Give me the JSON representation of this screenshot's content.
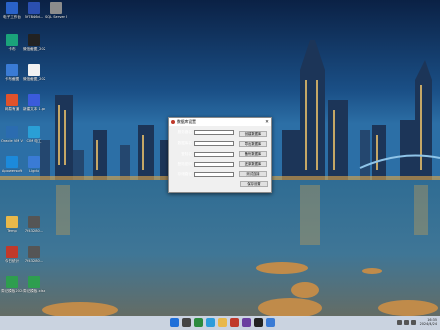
{
  "desktop": {
    "icons": [
      {
        "label": "电子工作台",
        "color": "#2a62c9"
      },
      {
        "label": "5f7846d...",
        "color": "#2b4fb0"
      },
      {
        "label": "SQL Server Manage...",
        "color": "#8c8c8c"
      },
      {
        "label": "卡布",
        "color": "#1aa37a"
      },
      {
        "label": "微信截图_2023082...",
        "color": "#222222"
      },
      {
        "label": "卡布截图",
        "color": "#3a7bd5"
      },
      {
        "label": "微信截图_2023082...",
        "color": "#f2f2f2"
      },
      {
        "label": "网易有道",
        "color": "#e0522b"
      },
      {
        "label": "新建文本 1.png",
        "color": "#3b5bdb"
      },
      {
        "label": "Oracle VM VirtualBox",
        "color": "#2b6cb0"
      },
      {
        "label": "CIM 电工",
        "color": "#2a9fd6"
      },
      {
        "label": "Apowersoft",
        "color": "#1c8adb"
      },
      {
        "label": "Ligdu",
        "color": "#3a7bd5"
      },
      {
        "label": "Temp",
        "color": "#e8b84a"
      },
      {
        "label": "7f43280...",
        "color": "#555555"
      },
      {
        "label": "今日统计",
        "color": "#c0392b"
      },
      {
        "label": "7f43280...",
        "color": "#555555"
      },
      {
        "label": "周记模板20240...",
        "color": "#2e9e4f"
      },
      {
        "label": "周记模板.xlsx",
        "color": "#2e9e4f"
      }
    ]
  },
  "dialog": {
    "title": "数据库设置",
    "fields": [
      {
        "label": "服务器名",
        "value": "."
      },
      {
        "label": "数据库名",
        "value": "yxfedb"
      },
      {
        "label": "登陆名",
        "value": "sa"
      },
      {
        "label": "登陆密码",
        "value": "********"
      },
      {
        "label": "存储路径",
        "value": "D:\\DATA"
      }
    ],
    "buttons": [
      "创建数据库",
      "导出数据库",
      "备份数据库",
      "还原数据库",
      "测试连接",
      "保存设置"
    ]
  },
  "taskbar": {
    "clock_time": "16:35",
    "clock_date": "2024/4/24"
  }
}
